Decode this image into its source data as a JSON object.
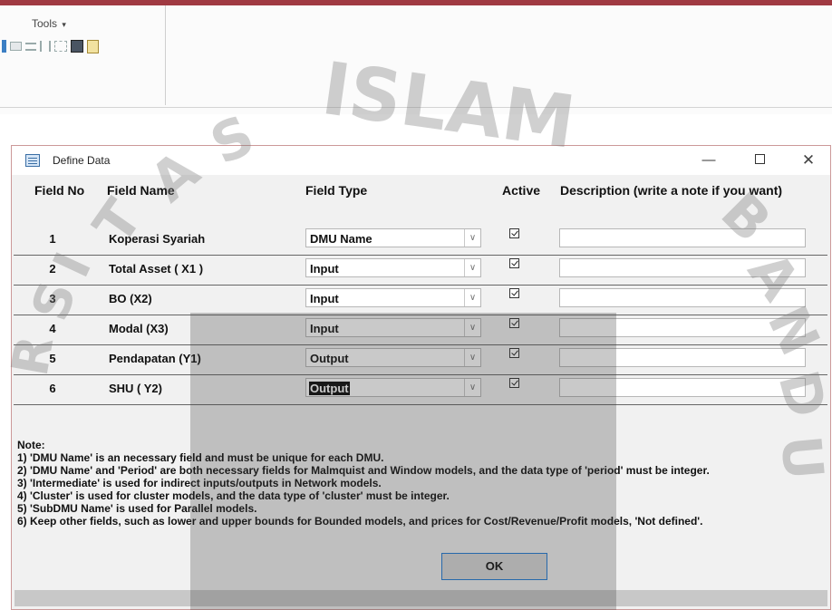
{
  "ribbon": {
    "tools_label": "Tools",
    "tools_caret": "▾"
  },
  "watermark": {
    "text": "ISLAM",
    "left_letters": [
      "S",
      "A",
      "T",
      "I",
      "S",
      "R"
    ],
    "right_letters": [
      "B",
      "A",
      "N",
      "D",
      "U"
    ]
  },
  "dialog": {
    "title": "Define Data",
    "controls": {
      "minimize": "—",
      "close": "✕"
    },
    "headers": {
      "field_no": "Field No",
      "field_name": "Field Name",
      "field_type": "Field Type",
      "active": "Active",
      "description": "Description (write a note if you want)"
    },
    "rows": [
      {
        "no": "1",
        "name": "Koperasi Syariah",
        "type": "DMU Name",
        "active": true,
        "description": ""
      },
      {
        "no": "2",
        "name": "Total Asset ( X1 )",
        "type": "Input",
        "active": true,
        "description": ""
      },
      {
        "no": "3",
        "name": "BO (X2)",
        "type": "Input",
        "active": true,
        "description": ""
      },
      {
        "no": "4",
        "name": "Modal (X3)",
        "type": "Input",
        "active": true,
        "description": ""
      },
      {
        "no": "5",
        "name": "Pendapatan (Y1)",
        "type": "Output",
        "active": true,
        "description": ""
      },
      {
        "no": "6",
        "name": "SHU ( Y2)",
        "type": "Output",
        "active": true,
        "description": ""
      }
    ],
    "notes": [
      "Note:",
      "1) 'DMU Name' is an necessary field and must be unique for each DMU.",
      "2) 'DMU Name' and 'Period' are both necessary fields for Malmquist and Window models,  and the data type of 'period' must be integer.",
      "3) 'Intermediate' is used for indirect inputs/outputs  in Network models.",
      "4) 'Cluster' is used for cluster models,  and the data type of  'cluster' must be integer.",
      "5) 'SubDMU Name' is used for Parallel models.",
      "6)  Keep other fields, such as lower and upper bounds for Bounded models, and prices for Cost/Revenue/Profit models, 'Not defined'."
    ],
    "ok_label": "OK"
  }
}
